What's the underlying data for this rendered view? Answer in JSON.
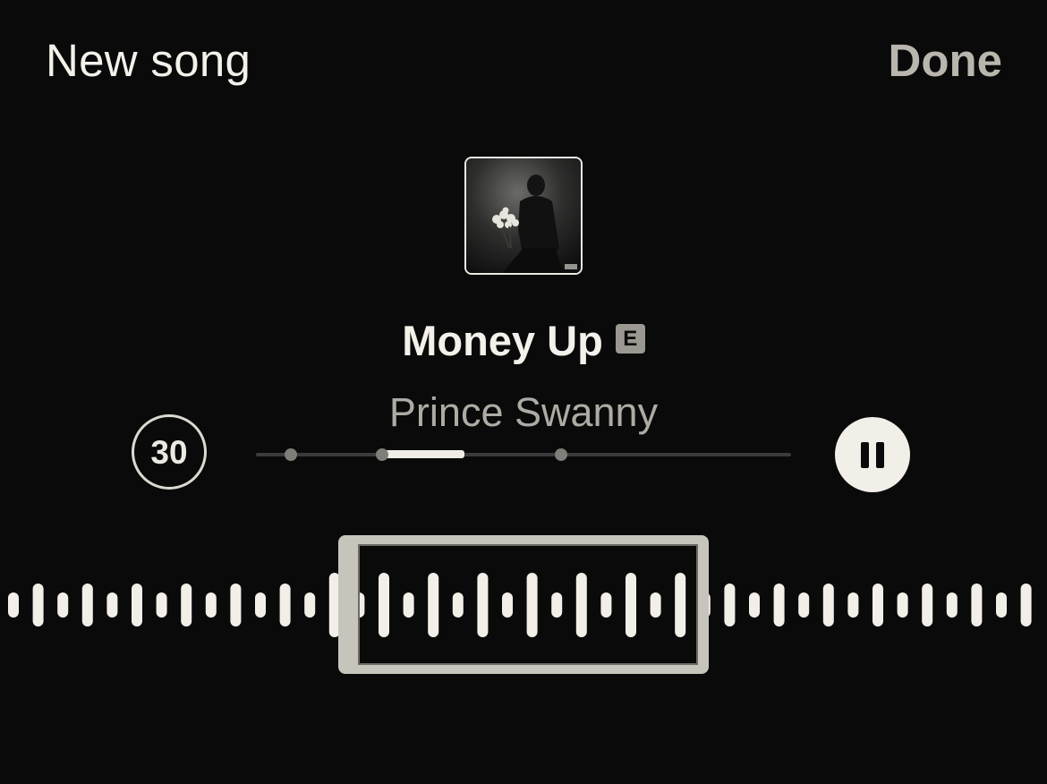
{
  "header": {
    "title": "New song",
    "done_label": "Done"
  },
  "song": {
    "title": "Money Up",
    "explicit_badge": "E",
    "artist": "Prince Swanny"
  },
  "controls": {
    "duration_seconds_label": "30",
    "play_state": "playing",
    "progress_marker_fractions": [
      0.065,
      0.235,
      0.57
    ],
    "progress_highlight_range_fraction": [
      0.235,
      0.39
    ]
  },
  "colors": {
    "background": "#0a0a0a",
    "primary_text": "#f4f1ea",
    "secondary_text": "#aeaba4",
    "done_text": "#b9b6ae"
  },
  "icons": {
    "pause": "pause-icon",
    "explicit": "explicit-icon"
  }
}
